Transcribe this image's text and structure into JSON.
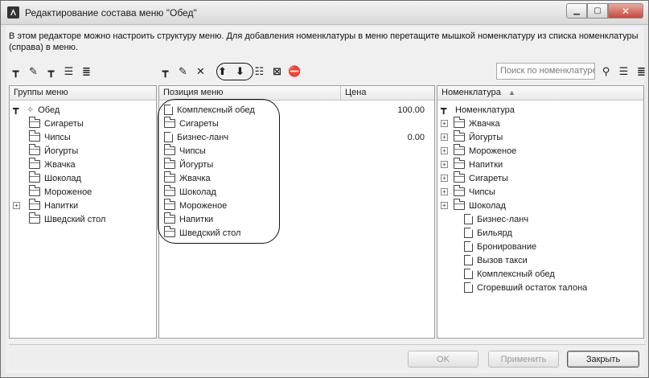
{
  "window": {
    "title": "Редактирование состава меню \"Обед\"",
    "info": "В этом редакторе можно настроить структуру меню.  Для добавления номенклатуры в меню перетащите мышкой номенклатуру из списка номенклатуры (справа) в меню."
  },
  "search": {
    "placeholder": "Поиск по номенклатуре"
  },
  "left_panel": {
    "header": "Группы меню",
    "root": "Обед",
    "items": [
      "Сигареты",
      "Чипсы",
      "Йогурты",
      "Жвачка",
      "Шоколад",
      "Мороженое",
      "Напитки",
      "Шведский стол"
    ]
  },
  "middle_panel": {
    "header_position": "Позиция меню",
    "header_price": "Цена",
    "items": [
      {
        "label": "Комплексный обед",
        "price": "100.00",
        "kind": "doc"
      },
      {
        "label": "Сигареты",
        "price": "",
        "kind": "folder"
      },
      {
        "label": "Бизнес-ланч",
        "price": "0.00",
        "kind": "doc"
      },
      {
        "label": "Чипсы",
        "price": "",
        "kind": "folder"
      },
      {
        "label": "Йогурты",
        "price": "",
        "kind": "folder"
      },
      {
        "label": "Жвачка",
        "price": "",
        "kind": "folder"
      },
      {
        "label": "Шоколад",
        "price": "",
        "kind": "folder"
      },
      {
        "label": "Мороженое",
        "price": "",
        "kind": "folder"
      },
      {
        "label": "Напитки",
        "price": "",
        "kind": "folder"
      },
      {
        "label": "Шведский стол",
        "price": "",
        "kind": "folder"
      }
    ]
  },
  "right_panel": {
    "header": "Номенклатура",
    "sort_indicator": "▲",
    "root": "Номенклатура",
    "groups": [
      "Жвачка",
      "Йогурты",
      "Мороженое",
      "Напитки",
      "Сигареты",
      "Чипсы",
      "Шоколад"
    ],
    "items": [
      "Бизнес-ланч",
      "Бильярд",
      "Бронирование",
      "Вызов такси",
      "Комплексный обед",
      "Сгоревший остаток талона"
    ]
  },
  "buttons": {
    "ok": "OK",
    "apply": "Применить",
    "close": "Закрыть"
  }
}
